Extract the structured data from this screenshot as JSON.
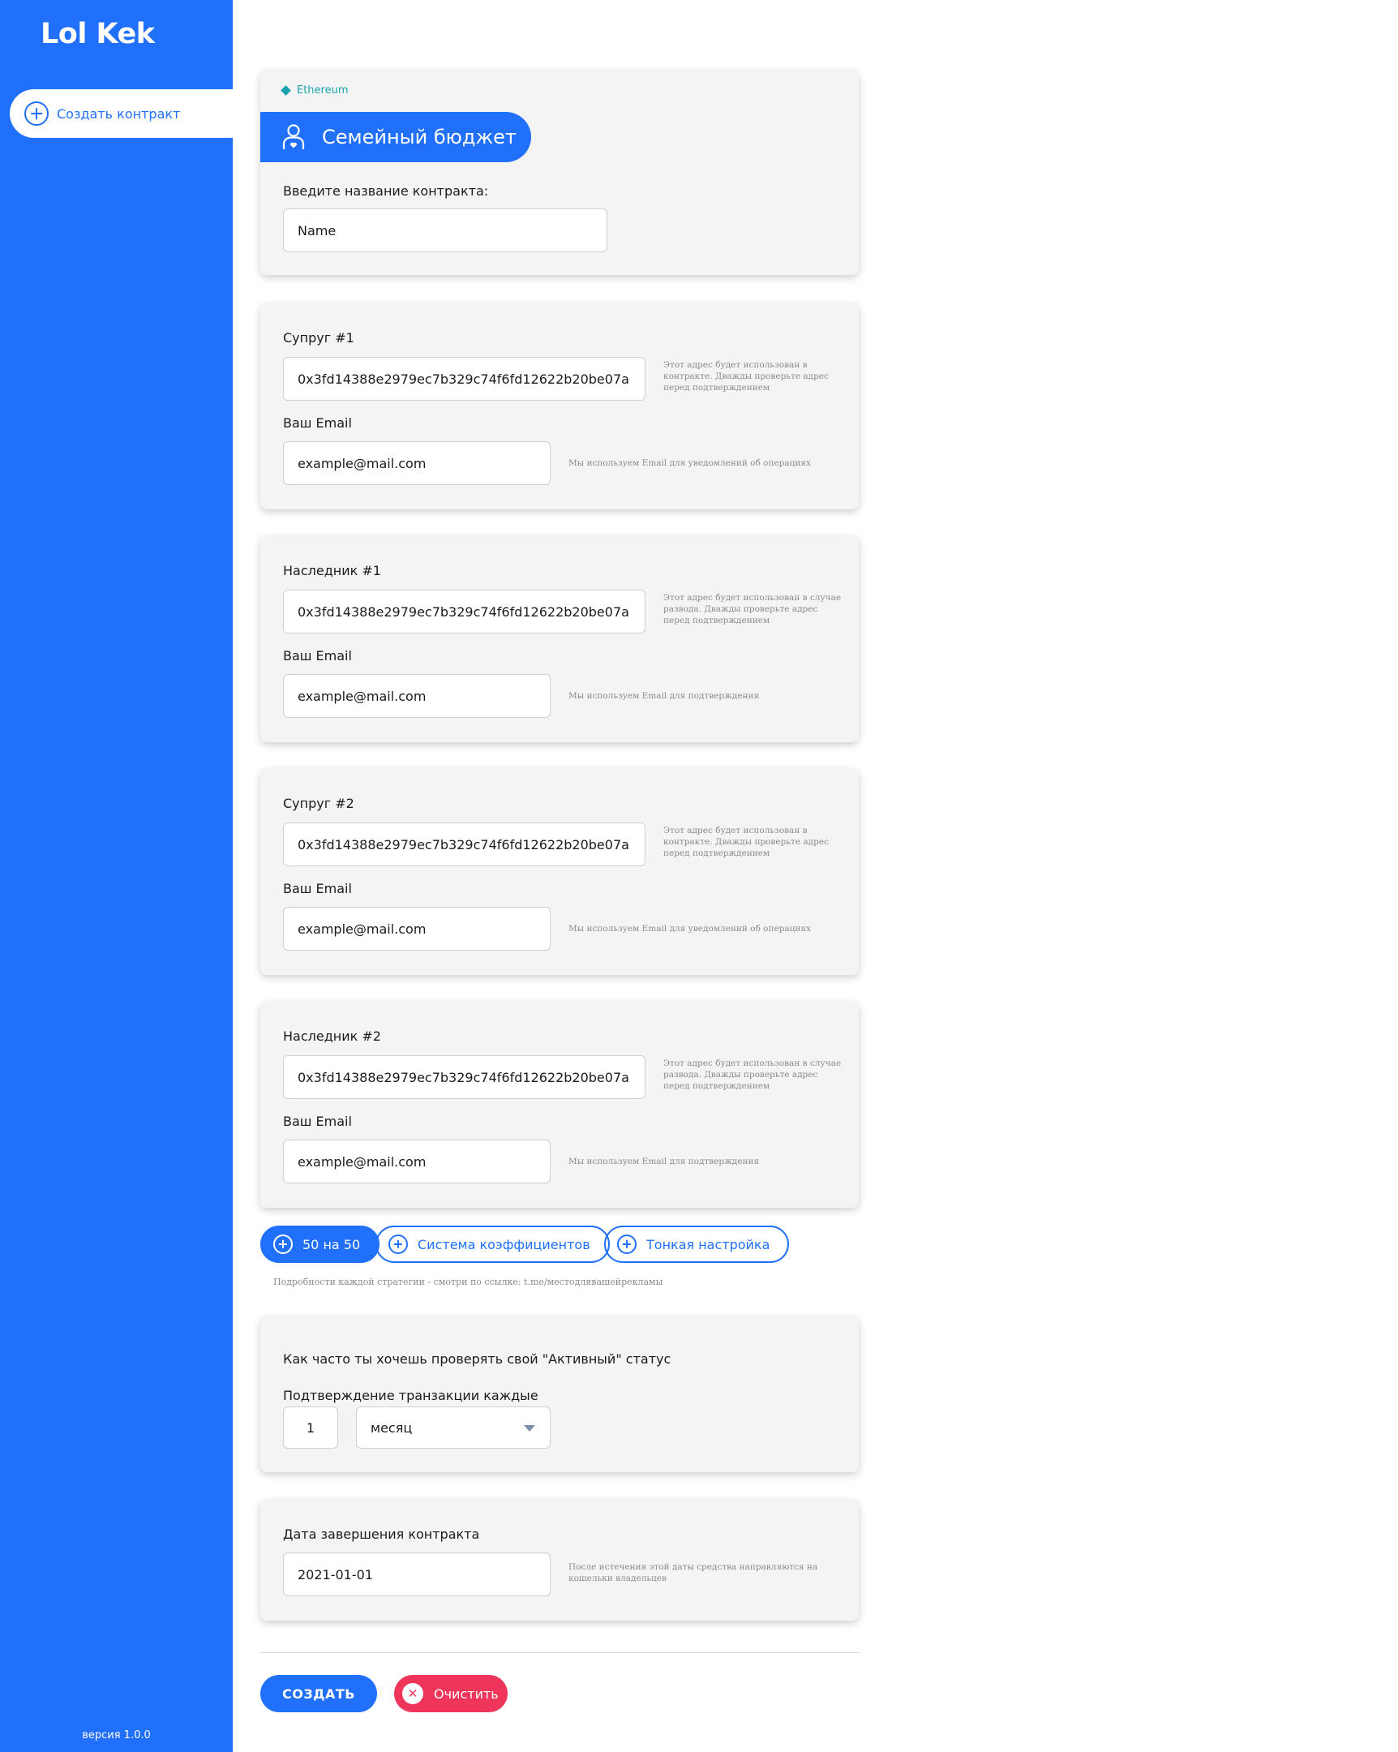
{
  "sidebar": {
    "logo": "Lol Kek",
    "create_label": "Создать контракт",
    "version": "версия 1.0.0"
  },
  "header_card": {
    "network": "Ethereum",
    "title": "Семейный бюджет",
    "name_label": "Введите название контракта:",
    "name_value": "Name"
  },
  "participants": [
    {
      "label": "Супруг #1",
      "address": "0x3fd14388e2979ec7b329c74f6fd12622b20be07a",
      "address_hint": "Этот адрес будет использован в контракте. Дважды проверьте адрес перед подтверждением",
      "email_label": "Ваш Email",
      "email": "example@mail.com",
      "email_hint": "Мы используем Email для уведомлений об операциях"
    },
    {
      "label": "Наследник #1",
      "address": "0x3fd14388e2979ec7b329c74f6fd12622b20be07a",
      "address_hint": "Этот адрес будет использован в случае развода. Дважды проверьте адрес перед подтверждением",
      "email_label": "Ваш Email",
      "email": "example@mail.com",
      "email_hint": "Мы используем Email для подтверждения"
    },
    {
      "label": "Супруг #2",
      "address": "0x3fd14388e2979ec7b329c74f6fd12622b20be07a",
      "address_hint": "Этот адрес будет использован в контракте. Дважды проверьте адрес перед подтверждением",
      "email_label": "Ваш Email",
      "email": "example@mail.com",
      "email_hint": "Мы используем Email для уведомлений об операциях"
    },
    {
      "label": "Наследник #2",
      "address": "0x3fd14388e2979ec7b329c74f6fd12622b20be07a",
      "address_hint": "Этот адрес будет использован в случае развода. Дважды проверьте адрес перед подтверждением",
      "email_label": "Ваш Email",
      "email": "example@mail.com",
      "email_hint": "Мы используем Email для подтверждения"
    }
  ],
  "strategies": {
    "items": [
      "50 на 50",
      "Система коэффициентов",
      "Тонкая настройка"
    ],
    "selected": "50 на 50",
    "note": "Подробности каждой стратегии - смотри по ссылке: t.me/местодлявашейрекламы"
  },
  "activity": {
    "question": "Как часто ты хочешь проверять свой \"Активный\" статус",
    "label": "Подтверждение транзакции каждые",
    "count": "1",
    "period": "месяц"
  },
  "end_date": {
    "label": "Дата завершения контракта",
    "value": "2021-01-01",
    "hint": "После истечения этой даты средства направляются на кошельки владельцев"
  },
  "actions": {
    "create": "СОЗДАТЬ",
    "clear": "Очистить"
  },
  "colors": {
    "accent": "#2170fb",
    "network": "#19a4b0",
    "danger": "#f0355a",
    "card_bg": "#f4f4f4"
  }
}
